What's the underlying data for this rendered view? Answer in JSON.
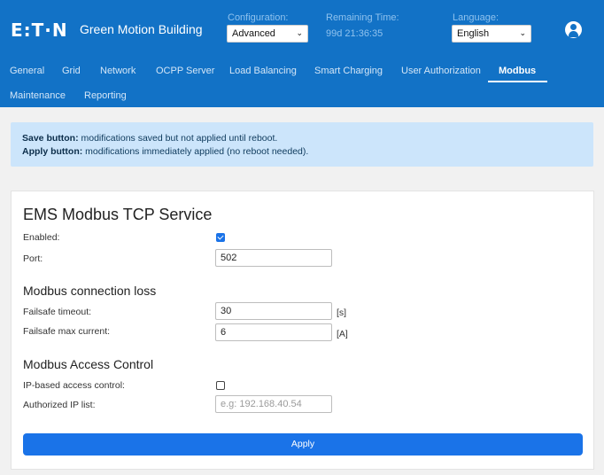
{
  "header": {
    "logo_text": "E:T·N",
    "app_title": "Green Motion Building",
    "configuration_label": "Configuration:",
    "configuration_value": "Advanced",
    "remaining_label": "Remaining Time:",
    "remaining_value": "99d 21:36:35",
    "language_label": "Language:",
    "language_value": "English",
    "brand_color": "#1272c6"
  },
  "nav": {
    "items": [
      {
        "label": "General"
      },
      {
        "label": "Grid"
      },
      {
        "label": "Network"
      },
      {
        "label": "OCPP Server"
      },
      {
        "label": "Load Balancing"
      },
      {
        "label": "Smart Charging"
      },
      {
        "label": "User Authorization"
      },
      {
        "label": "Modbus",
        "active": true
      },
      {
        "label": "Maintenance"
      },
      {
        "label": "Reporting"
      }
    ]
  },
  "info": {
    "save_bold": "Save button:",
    "save_text": " modifications saved but not applied until reboot.",
    "apply_bold": "Apply button:",
    "apply_text": " modifications immediately applied (no reboot needed)."
  },
  "form": {
    "title": "EMS Modbus TCP Service",
    "enabled_label": "Enabled:",
    "enabled_checked": true,
    "port_label": "Port:",
    "port_value": "502",
    "conn_loss_title": "Modbus connection loss",
    "failsafe_timeout_label": "Failsafe timeout:",
    "failsafe_timeout_value": "30",
    "failsafe_timeout_unit": "[s]",
    "failsafe_current_label": "Failsafe max current:",
    "failsafe_current_value": "6",
    "failsafe_current_unit": "[A]",
    "access_title": "Modbus Access Control",
    "ip_access_label": "IP-based access control:",
    "ip_access_checked": false,
    "authorized_ip_label": "Authorized IP list:",
    "authorized_ip_placeholder": "e.g: 192.168.40.54",
    "apply_label": "Apply",
    "accent_color": "#1a73e8"
  }
}
